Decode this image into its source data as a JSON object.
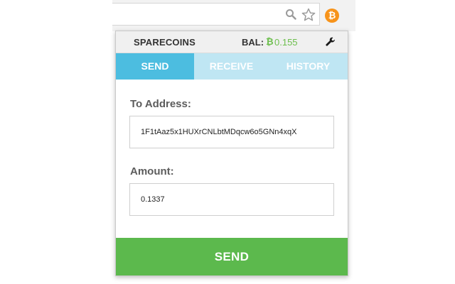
{
  "browser": {
    "zoom_icon": "magnifier-icon",
    "bookmark_icon": "star-icon",
    "extension_icon": {
      "name": "bitcoin-icon",
      "glyph": "₿",
      "color": "#f7931a"
    }
  },
  "header": {
    "app_name": "SPARECOINS",
    "balance_label": "BAL:",
    "balance_symbol": "₿",
    "balance_value": "0.155",
    "balance_color": "#6cbe4c",
    "settings_icon": "wrench-icon"
  },
  "tabs": [
    {
      "label": "SEND",
      "active": true
    },
    {
      "label": "RECEIVE",
      "active": false
    },
    {
      "label": "HISTORY",
      "active": false
    }
  ],
  "form": {
    "address_label": "To Address:",
    "address_value": "1F1tAaz5x1HUXrCNLbtMDqcw6o5GNn4xqX",
    "amount_label": "Amount:",
    "amount_value": "0.1337",
    "submit_label": "SEND"
  },
  "colors": {
    "tab_active": "#4cbde0",
    "tab_inactive": "#bfe6f3",
    "send_button": "#5cb94d"
  }
}
